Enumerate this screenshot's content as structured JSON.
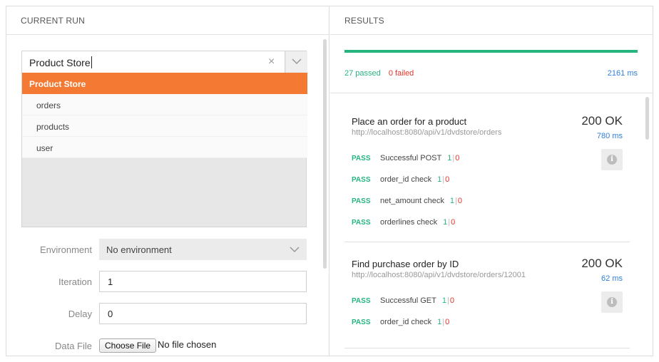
{
  "left": {
    "header": "CURRENT RUN",
    "collection_input": "Product Store",
    "dropdown": [
      {
        "label": "Product Store",
        "selected": true
      },
      {
        "label": "orders",
        "selected": false
      },
      {
        "label": "products",
        "selected": false
      },
      {
        "label": "user",
        "selected": false
      }
    ],
    "environment": {
      "label": "Environment",
      "value": "No environment"
    },
    "iteration": {
      "label": "Iteration",
      "value": "1"
    },
    "delay": {
      "label": "Delay",
      "value": "0"
    },
    "data_file": {
      "label": "Data File",
      "button": "Choose File",
      "status": "No file chosen"
    }
  },
  "right": {
    "header": "RESULTS",
    "progress_fraction": 1.0,
    "passed": "27 passed",
    "failed": "0 failed",
    "total_time": "2161 ms",
    "requests": [
      {
        "name": "Place an order for a product",
        "url": "http://localhost:8080/api/v1/dvdstore/orders",
        "status": "200 OK",
        "time": "780 ms",
        "tests": [
          {
            "result": "PASS",
            "name": "Successful POST",
            "pass": "1",
            "fail": "0"
          },
          {
            "result": "PASS",
            "name": "order_id check",
            "pass": "1",
            "fail": "0"
          },
          {
            "result": "PASS",
            "name": "net_amount check",
            "pass": "1",
            "fail": "0"
          },
          {
            "result": "PASS",
            "name": "orderlines check",
            "pass": "1",
            "fail": "0"
          }
        ]
      },
      {
        "name": "Find purchase order by ID",
        "url": "http://localhost:8080/api/v1/dvdstore/orders/12001",
        "status": "200 OK",
        "time": "62 ms",
        "tests": [
          {
            "result": "PASS",
            "name": "Successful GET",
            "pass": "1",
            "fail": "0"
          },
          {
            "result": "PASS",
            "name": "order_id check",
            "pass": "1",
            "fail": "0"
          }
        ]
      }
    ]
  },
  "colors": {
    "accent": "#f47a34",
    "pass": "#26b47f",
    "fail": "#e2352a",
    "link": "#2f7fd7"
  },
  "icons": {
    "clear": "close-icon",
    "dropdown": "chevron-down-icon",
    "info": "info-icon"
  }
}
